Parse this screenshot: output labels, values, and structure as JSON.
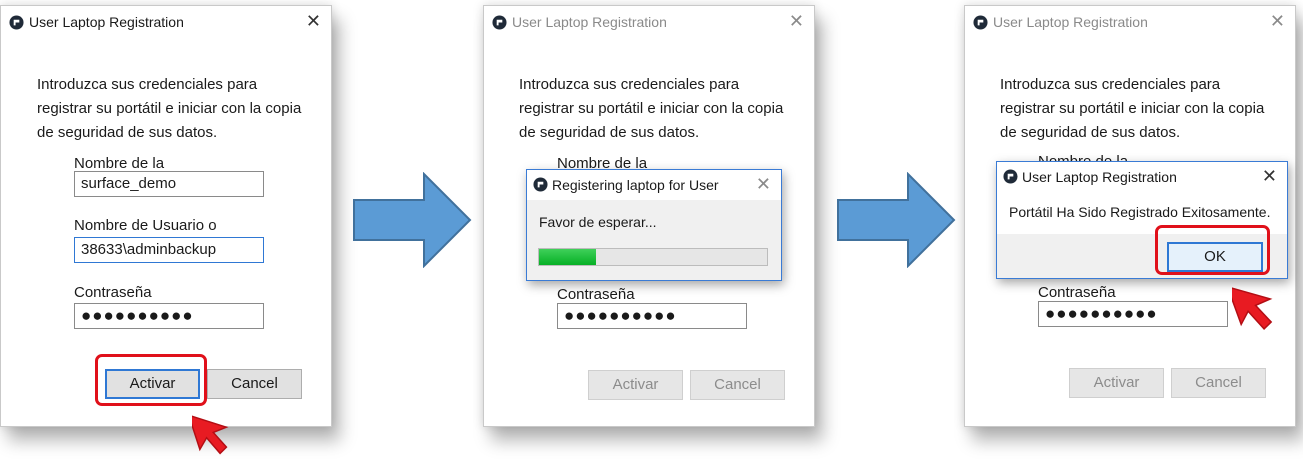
{
  "panels": [
    {
      "window_title": "User Laptop Registration",
      "intro_line1": "Introduzca sus credenciales para",
      "intro_line2": "registrar su portátil e iniciar con la copia",
      "intro_line3": "de seguridad de sus datos.",
      "domain_label": "Nombre de la",
      "domain_value": "surface_demo",
      "user_label": "Nombre de Usuario o",
      "user_value": "38633\\adminbackup",
      "password_label": "Contraseña",
      "password_value": "●●●●●●●●●●",
      "activate_label": "Activar",
      "cancel_label": "Cancel",
      "close_glyph": "✕"
    },
    {
      "window_title": "User Laptop Registration",
      "intro_line1": "Introduzca sus credenciales para",
      "intro_line2": "registrar su portátil e iniciar con la copia",
      "intro_line3": "de seguridad de sus datos.",
      "domain_label": "Nombre de la",
      "password_label": "Contraseña",
      "password_value": "●●●●●●●●●●",
      "activate_label": "Activar",
      "cancel_label": "Cancel",
      "close_glyph": "✕",
      "progress_dialog": {
        "title": "Registering laptop for User",
        "message": "Favor de esperar...",
        "progress": 0.25,
        "close_glyph": "✕"
      }
    },
    {
      "window_title": "User Laptop Registration",
      "intro_line1": "Introduzca sus credenciales para",
      "intro_line2": "registrar su portátil e iniciar con la copia",
      "intro_line3": "de seguridad de sus datos.",
      "domain_label": "Nombre de la",
      "password_label": "Contraseña",
      "password_value": "●●●●●●●●●●",
      "activate_label": "Activar",
      "cancel_label": "Cancel",
      "close_glyph": "✕",
      "result_dialog": {
        "title": "User Laptop Registration",
        "message": "Portátil Ha Sido Registrado Exitosamente.",
        "ok_label": "OK",
        "close_glyph": "✕"
      }
    }
  ],
  "colors": {
    "highlight": "#e0101a",
    "arrow_fill": "#5b9bd5",
    "arrow_stroke": "#41719c",
    "focus_border": "#2f78d4",
    "progress_green": "#06b025"
  },
  "icons": [
    "app-logo-icon",
    "close-icon",
    "red-cursor-icon",
    "step-arrow-icon"
  ]
}
